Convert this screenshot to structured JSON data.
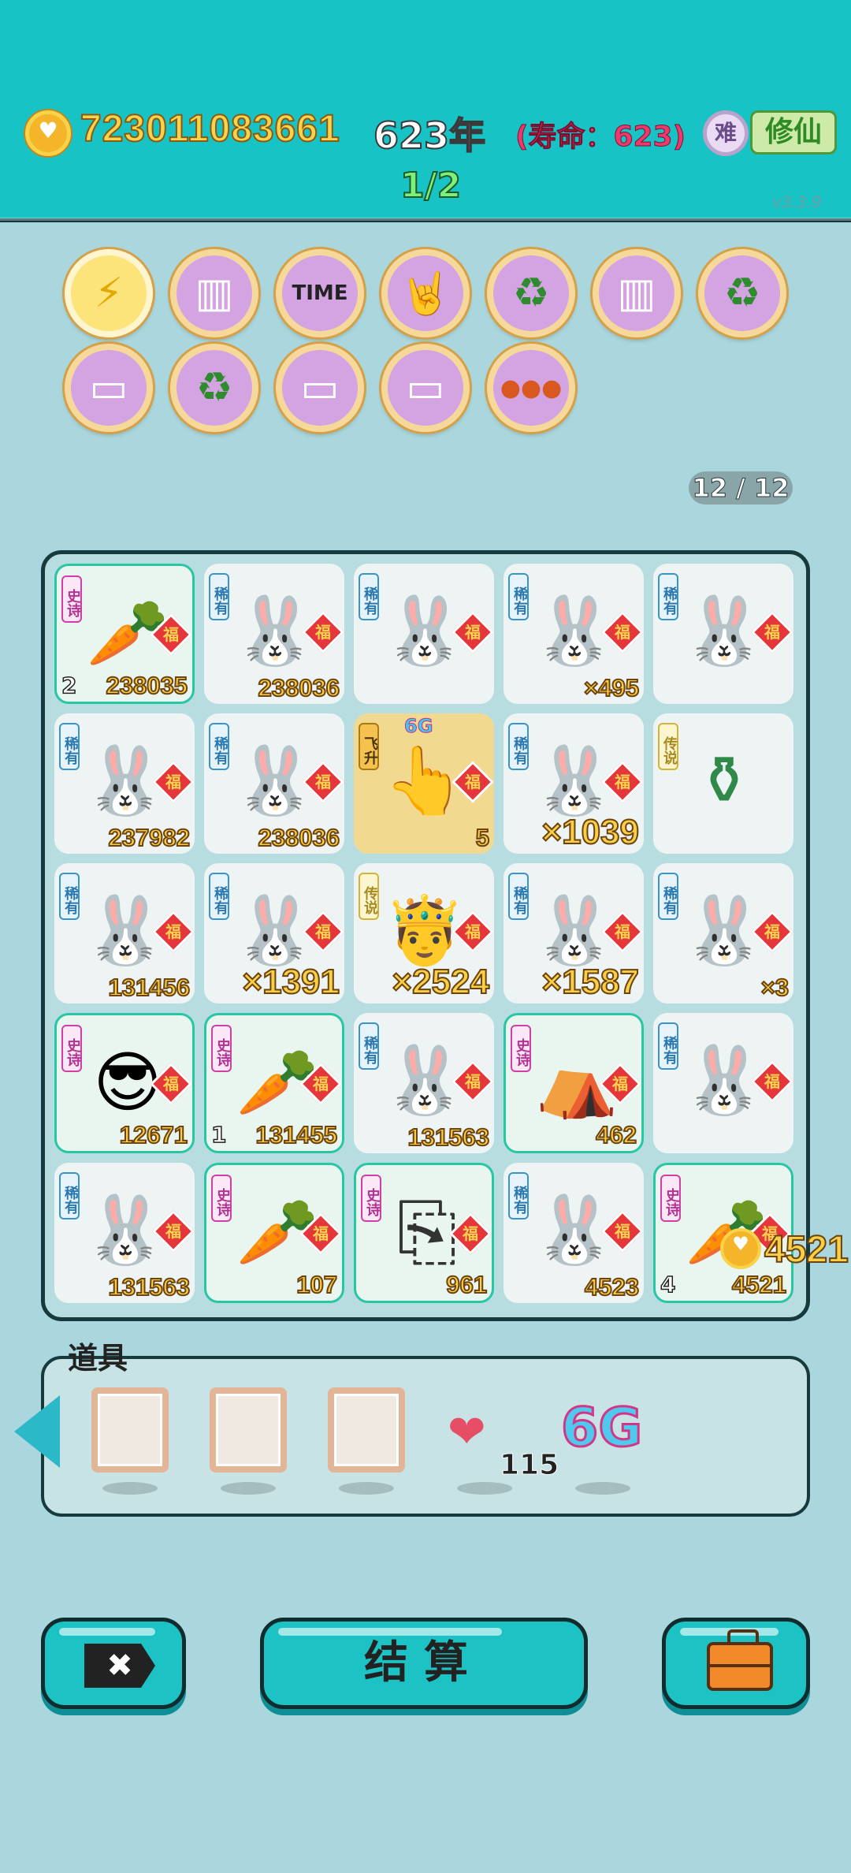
{
  "header": {
    "coins": "723011083661",
    "year": "623年",
    "lifespan": "(寿命：623)",
    "difficulty": "难",
    "cultivate_label": "修仙",
    "stage": "1/2",
    "version": "v3.3.9"
  },
  "relics": [
    {
      "icon": "lightning-icon",
      "glyph": "⚡"
    },
    {
      "icon": "skirt-icon",
      "glyph": "▥"
    },
    {
      "icon": "time-magazine-icon",
      "glyph": "TIME"
    },
    {
      "icon": "rock-hand-icon",
      "glyph": "🤘"
    },
    {
      "icon": "recycle-icon",
      "glyph": "♻"
    },
    {
      "icon": "skirt-icon",
      "glyph": "▥"
    },
    {
      "icon": "recycle-icon",
      "glyph": "♻"
    },
    {
      "icon": "tissue-box-icon",
      "glyph": "▭"
    },
    {
      "icon": "recycle-icon",
      "glyph": "♻"
    },
    {
      "icon": "tissue-box-icon",
      "glyph": "▭"
    },
    {
      "icon": "tissue-box-icon",
      "glyph": "▭"
    },
    {
      "icon": "basketballs-icon",
      "glyph": "●●●"
    }
  ],
  "relic_counter": "12 / 12",
  "fu_label": "福",
  "board": [
    {
      "tag": "史诗",
      "kind": "epic",
      "icon": "carrot-icon",
      "value": "238035",
      "level": "2"
    },
    {
      "tag": "稀有",
      "kind": "rare",
      "icon": "bunny-icon",
      "value": "238036"
    },
    {
      "tag": "稀有",
      "kind": "rare",
      "icon": "bunny-icon",
      "value": ""
    },
    {
      "tag": "稀有",
      "kind": "rare",
      "icon": "bunny-icon",
      "value": "×495"
    },
    {
      "tag": "稀有",
      "kind": "rare",
      "icon": "bunny-icon",
      "value": ""
    },
    {
      "tag": "稀有",
      "kind": "rare",
      "icon": "bunny-icon",
      "value": "237982"
    },
    {
      "tag": "稀有",
      "kind": "rare",
      "icon": "bunny-icon",
      "value": "238036"
    },
    {
      "tag": "飞升",
      "kind": "fly",
      "icon": "pointing-hand-icon",
      "value": "5",
      "badge": "6G"
    },
    {
      "tag": "稀有",
      "kind": "rare",
      "icon": "bunny-icon",
      "value": "×1039"
    },
    {
      "tag": "传说",
      "kind": "leg",
      "icon": "jade-vase-icon",
      "value": ""
    },
    {
      "tag": "稀有",
      "kind": "rare",
      "icon": "bunny-icon",
      "value": "131456"
    },
    {
      "tag": "稀有",
      "kind": "rare",
      "icon": "bunny-icon",
      "value": "×1391"
    },
    {
      "tag": "传说",
      "kind": "leg",
      "icon": "crowned-old-man-icon",
      "value": "×2524"
    },
    {
      "tag": "稀有",
      "kind": "rare",
      "icon": "bunny-icon",
      "value": "×1587"
    },
    {
      "tag": "稀有",
      "kind": "rare",
      "icon": "bunny-icon",
      "value": "×3"
    },
    {
      "tag": "史诗",
      "kind": "epic",
      "icon": "green-hat-man-icon",
      "value": "12671"
    },
    {
      "tag": "史诗",
      "kind": "epic",
      "icon": "carrot-icon",
      "value": "131455",
      "level": "1"
    },
    {
      "tag": "稀有",
      "kind": "rare",
      "icon": "bunny-icon",
      "value": "131563"
    },
    {
      "tag": "史诗",
      "kind": "epic",
      "icon": "bunny-tent-icon",
      "value": "462"
    },
    {
      "tag": "稀有",
      "kind": "rare",
      "icon": "bunny-icon",
      "value": ""
    },
    {
      "tag": "稀有",
      "kind": "rare",
      "icon": "bunny-icon",
      "value": "131563"
    },
    {
      "tag": "史诗",
      "kind": "epic",
      "icon": "carrot-icon",
      "value": "107"
    },
    {
      "tag": "史诗",
      "kind": "epic",
      "icon": "copy-paste-icon",
      "value": "961"
    },
    {
      "tag": "稀有",
      "kind": "rare",
      "icon": "bunny-icon",
      "value": "4523"
    },
    {
      "tag": "史诗",
      "kind": "epic",
      "icon": "carrot-icon",
      "value": "4521",
      "level": "4"
    }
  ],
  "floating_gain": "4521",
  "props": {
    "title": "道具",
    "liver_count": "115",
    "sixg_label": "6G"
  },
  "buttons": {
    "cancel_label": "✖",
    "settle_label": "结算"
  },
  "colors": {
    "header_bg": "#18c3c6",
    "page_bg": "#a9d7dd",
    "coin_gold": "#f8cf45",
    "rare_blue": "#3a93c9",
    "epic_pink": "#cf3fa6",
    "legend_gold": "#d3b335"
  }
}
